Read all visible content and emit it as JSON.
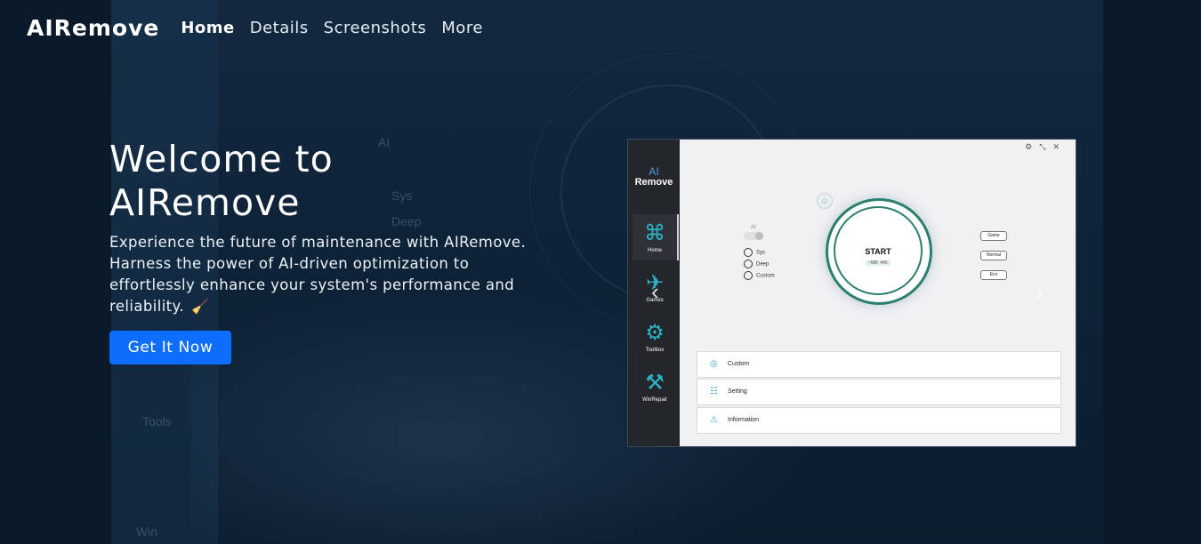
{
  "nav": {
    "brand": "AIRemove",
    "links": [
      "Home",
      "Details",
      "Screenshots",
      "More"
    ]
  },
  "hero": {
    "title_line1": "Welcome to",
    "title_line2": "AIRemove",
    "description": "Experience the future of maintenance with AIRemove. Harness the power of AI-driven optimization to effortlessly enhance your system's performance and reliability.",
    "cta_label": "Get It Now"
  },
  "background": {
    "ghost_labels": [
      "AI",
      "Sys",
      "Deep",
      "Tools",
      "Win"
    ]
  },
  "screenshot": {
    "logo_line1": "AI",
    "logo_line2": "Remove",
    "sidebar": [
      "Home",
      "Games",
      "Toolbox",
      "WinRepair"
    ],
    "toggle_label": "AI",
    "scan_modes": [
      "Sys",
      "Deep",
      "Custom"
    ],
    "start_label": "START",
    "start_sub": "~MB: 445",
    "power_modes": [
      "Game",
      "Normal",
      "Eco"
    ],
    "rows": [
      "Custom",
      "Setting",
      "Information"
    ],
    "top_icons": [
      "gear-icon",
      "minimize-icon",
      "close-icon"
    ]
  },
  "colors": {
    "page_bg": "#0a1a2b",
    "cta_bg": "#0d6efd",
    "accent_teal": "#2c7f6d",
    "sidebar_bg": "#23262b"
  }
}
